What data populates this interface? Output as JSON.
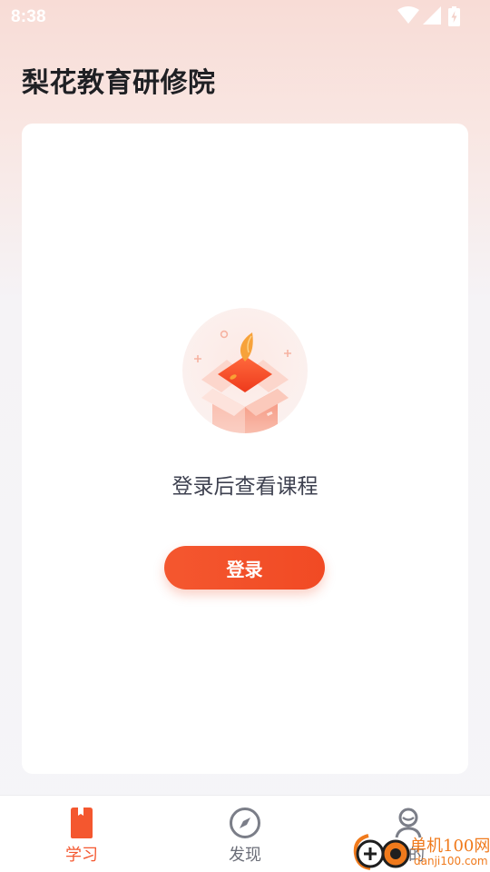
{
  "status_bar": {
    "time": "8:38",
    "icons": [
      "wifi-icon",
      "signal-icon",
      "battery-icon"
    ]
  },
  "header": {
    "title": "梨花教育研修院"
  },
  "main": {
    "empty_state": {
      "illustration": "gift-box-icon",
      "message": "登录后查看课程",
      "button_label": "登录"
    }
  },
  "bottom_nav": {
    "items": [
      {
        "label": "学习",
        "icon": "book-icon",
        "active": true
      },
      {
        "label": "发现",
        "icon": "compass-icon",
        "active": false
      },
      {
        "label": "我的",
        "icon": "user-icon",
        "active": false
      }
    ]
  },
  "watermark": {
    "name": "单机100网",
    "url": "danji100.com"
  },
  "colors": {
    "accent": "#f4572f",
    "title_text": "#1f2024",
    "body_text": "#3e4150",
    "nav_inactive": "#6b6e78",
    "watermark": "#f07a1c"
  }
}
